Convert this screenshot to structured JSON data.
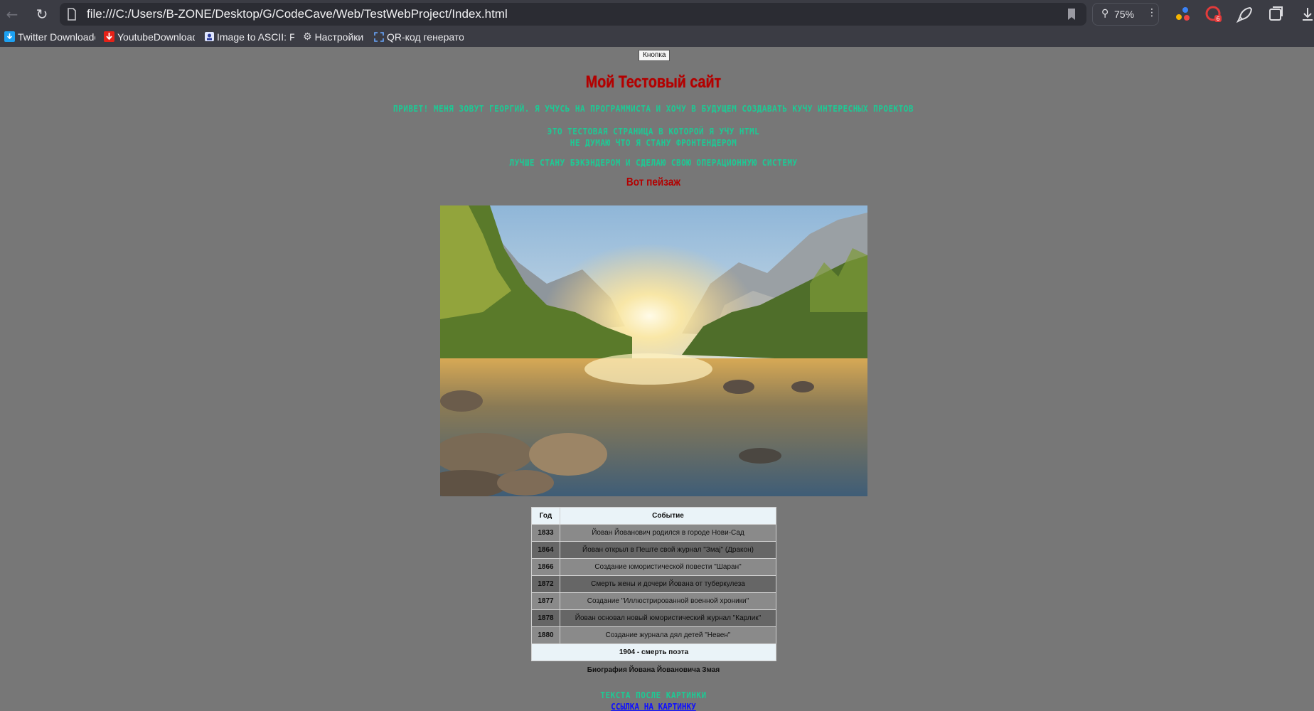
{
  "browser": {
    "address": "file:///C:/Users/B-ZONE/Desktop/G/CodeCave/Web/TestWebProject/Index.html",
    "zoom": "75%",
    "bookmarks": [
      {
        "label": "Twitter Downloade",
        "icon": "twitter-download-icon"
      },
      {
        "label": "YoutubeDownloade",
        "icon": "youtube-download-icon"
      },
      {
        "label": "Image to ASCII: Fr",
        "icon": "ascii-icon"
      },
      {
        "label": "Настройки",
        "icon": "gear-icon"
      },
      {
        "label": "QR-код генератор",
        "icon": "qr-code-icon"
      }
    ],
    "colors": {
      "chrome": "#3b3c44",
      "address_bg": "#2b2c33"
    }
  },
  "page": {
    "button_label": "Кнопка",
    "title": "Мой Тестовый сайт",
    "intro": "Привет! Меня зовут Георгий. Я учусь на программиста и хочу в будущем создавать кучу интересных проектов",
    "line1": "Это тестовая страница в которой я учу html",
    "line2": "Не думаю что я стану фронтендером",
    "line3": "Лучше стану бэкэндером и сделаю свою операционную систему",
    "landscape_heading": "Вот пейзаж",
    "photo_alt": "mountain lake landscape",
    "table": {
      "headers": [
        "Год",
        "Событие"
      ],
      "rows": [
        {
          "year": "1833",
          "event": "Йован Йованович родился в городе Нови-Сад"
        },
        {
          "year": "1864",
          "event": "Йован открыл в Пеште свой журнал \"Змај\" (Дракон)"
        },
        {
          "year": "1866",
          "event": "Создание юмористической повести \"Шаран\""
        },
        {
          "year": "1872",
          "event": "Смерть жены и дочери Йована от туберкулеза"
        },
        {
          "year": "1877",
          "event": "Создание \"Иллюстрированной военной хроники\""
        },
        {
          "year": "1878",
          "event": "Йован основал новый юмористический журнал \"Карлик\""
        },
        {
          "year": "1880",
          "event": "Создание журнала дял детей \"Невен\""
        }
      ],
      "footer": "1904 - смерть поэта",
      "caption": "Биография Йована Йовановича Змая"
    },
    "after_image_text": "Текста после картинки",
    "image_link": "Ссылка на картинку",
    "colors": {
      "background": "#777777",
      "title": "#b30000",
      "green": "#1ec994",
      "link": "#1010ff"
    }
  }
}
